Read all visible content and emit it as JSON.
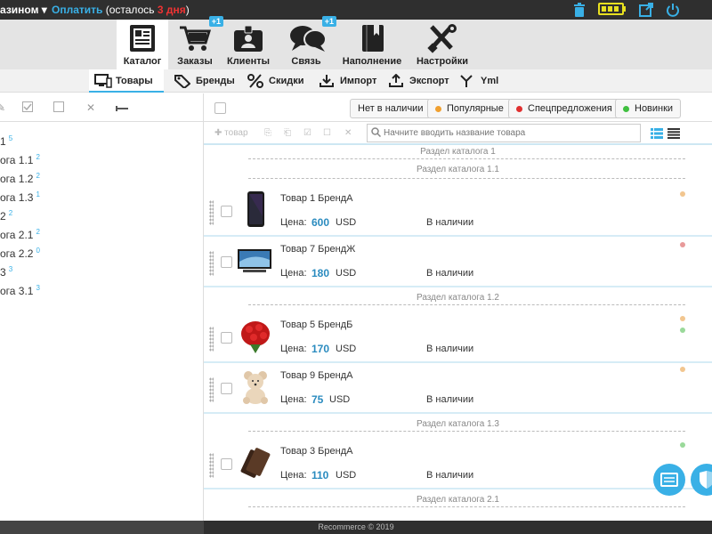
{
  "topbar": {
    "shop_menu": "азином ▾",
    "pay_link": "Оплатить",
    "pay_note_pre": " (осталось ",
    "pay_days": "3 дня",
    "pay_note_post": ")",
    "icons": [
      "trash-icon",
      "battery-icon",
      "external-link-icon",
      "power-icon"
    ]
  },
  "modules": [
    {
      "label": "Каталог",
      "icon": "catalog-icon",
      "active": true
    },
    {
      "label": "Заказы",
      "icon": "cart-icon",
      "badge": "+1"
    },
    {
      "label": "Клиенты",
      "icon": "clients-icon"
    },
    {
      "label": "Связь",
      "icon": "chat-icon",
      "badge": "+1"
    },
    {
      "label": "Наполнение",
      "icon": "book-icon"
    },
    {
      "label": "Настройки",
      "icon": "settings-icon"
    }
  ],
  "subtabs": [
    {
      "label": "Товары",
      "icon": "products-icon",
      "active": true
    },
    {
      "label": "Бренды",
      "icon": "tag-icon"
    },
    {
      "label": "Скидки",
      "icon": "percent-icon"
    },
    {
      "label": "Импорт",
      "icon": "import-icon"
    },
    {
      "label": "Экспорт",
      "icon": "export-icon"
    },
    {
      "label": "Yml",
      "icon": "yml-icon"
    }
  ],
  "tree": [
    {
      "label": "1",
      "count": "5"
    },
    {
      "label": "ога 1.1",
      "count": "2"
    },
    {
      "label": "ога 1.2",
      "count": "2"
    },
    {
      "label": "ога 1.3",
      "count": "1"
    },
    {
      "label": "2",
      "count": "2"
    },
    {
      "label": "ога 2.1",
      "count": "2"
    },
    {
      "label": "ога 2.2",
      "count": "0"
    },
    {
      "label": "3",
      "count": "3"
    },
    {
      "label": "ога 3.1",
      "count": "3"
    }
  ],
  "filters": [
    {
      "label": "Нет в наличии",
      "dot": ""
    },
    {
      "label": "Популярные",
      "dot": "#f0a030"
    },
    {
      "label": "Спецпредложения",
      "dot": "#e03030"
    },
    {
      "label": "Новинки",
      "dot": "#40c040"
    }
  ],
  "toolbar": {
    "add_label": "товар",
    "search_placeholder": "Начните вводить название товара"
  },
  "list": [
    {
      "type": "section",
      "label": "Раздел каталога 1"
    },
    {
      "type": "section",
      "label": "Раздел каталога 1.1"
    },
    {
      "type": "product",
      "name": "Товар 1 БрендА",
      "price_label": "Цена:",
      "price": "600",
      "currency": "USD",
      "stock": "В наличии",
      "image": "phone",
      "indicators": [
        "#f2c68f"
      ]
    },
    {
      "type": "product",
      "name": "Товар 7 БрендЖ",
      "price_label": "Цена:",
      "price": "180",
      "currency": "USD",
      "stock": "В наличии",
      "image": "tv",
      "indicators": [
        "#e89a9a"
      ]
    },
    {
      "type": "section",
      "label": "Раздел каталога 1.2"
    },
    {
      "type": "product",
      "name": "Товар 5 БрендБ",
      "price_label": "Цена:",
      "price": "170",
      "currency": "USD",
      "stock": "В наличии",
      "image": "roses",
      "indicators": [
        "#f2c68f",
        "#9ad99a"
      ]
    },
    {
      "type": "product",
      "name": "Товар 9 БрендА",
      "price_label": "Цена:",
      "price": "75",
      "currency": "USD",
      "stock": "В наличии",
      "image": "teddy",
      "indicators": [
        "#f2c68f"
      ]
    },
    {
      "type": "section",
      "label": "Раздел каталога 1.3"
    },
    {
      "type": "product",
      "name": "Товар 3 БрендА",
      "price_label": "Цена:",
      "price": "110",
      "currency": "USD",
      "stock": "В наличии",
      "image": "wallet",
      "indicators": [
        "#9ad99a"
      ]
    },
    {
      "type": "section",
      "label": "Раздел каталога 2.1"
    }
  ],
  "footer": {
    "copyright": "Recommerce © 2019"
  },
  "colors": {
    "accent": "#39b0e6",
    "price": "#2a8bbf",
    "dark": "#2f2f2f"
  }
}
